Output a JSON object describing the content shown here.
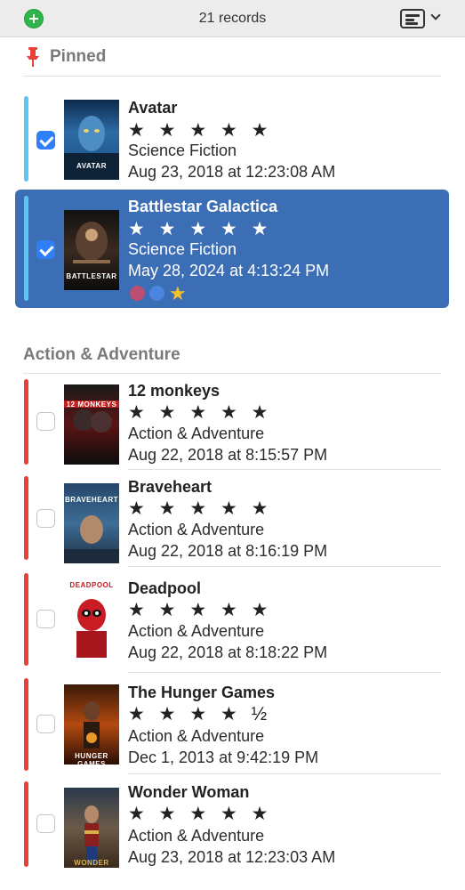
{
  "toolbar": {
    "record_count": "21 records",
    "add_icon": "plus-circle-icon",
    "view_icon": "list-view-icon",
    "add_color": "#2fb64a"
  },
  "sections": {
    "pinned_label": "Pinned",
    "action_label": "Action & Adventure"
  },
  "colors": {
    "selection": "#3c6eb5",
    "pinned_bar": "#5ac6f5",
    "category_bar": "#e8413a",
    "checkbox_checked": "#2f7ff6"
  },
  "pinned": [
    {
      "title": "Avatar",
      "stars": "★ ★ ★ ★ ★",
      "genre": "Science Fiction",
      "date": "Aug 23, 2018 at 12:23:08 AM",
      "checked": true,
      "poster_text": "AVATAR"
    },
    {
      "title": "Battlestar Galactica",
      "stars": "★ ★ ★ ★ ★",
      "genre": "Science Fiction",
      "date": "May 28, 2024 at 4:13:24 PM",
      "checked": true,
      "selected": true,
      "poster_text": "BATTLESTAR"
    }
  ],
  "action": [
    {
      "title": "12 monkeys",
      "stars": "★ ★ ★ ★ ★",
      "genre": "Action & Adventure",
      "date": "Aug 22, 2018 at 8:15:57 PM",
      "checked": false,
      "poster_text": "12 MONKEYS"
    },
    {
      "title": "Braveheart",
      "stars": "★ ★ ★ ★ ★",
      "genre": "Action & Adventure",
      "date": "Aug 22, 2018 at 8:16:19 PM",
      "checked": false,
      "poster_text": "BRAVEHEART"
    },
    {
      "title": "Deadpool",
      "stars": "★ ★ ★ ★ ★",
      "genre": "Action & Adventure",
      "date": "Aug 22, 2018 at 8:18:22 PM",
      "checked": false,
      "poster_text": "DEADPOOL"
    },
    {
      "title": "The Hunger Games",
      "stars": "★ ★ ★ ★ ½",
      "genre": "Action & Adventure",
      "date": "Dec 1, 2013 at 9:42:19 PM",
      "checked": false,
      "poster_text": "HUNGER GAMES"
    },
    {
      "title": "Wonder Woman",
      "stars": "★ ★ ★ ★ ★",
      "genre": "Action & Adventure",
      "date": "Aug 23, 2018 at 12:23:03 AM",
      "checked": false,
      "poster_text": "WONDER WOMAN"
    }
  ]
}
